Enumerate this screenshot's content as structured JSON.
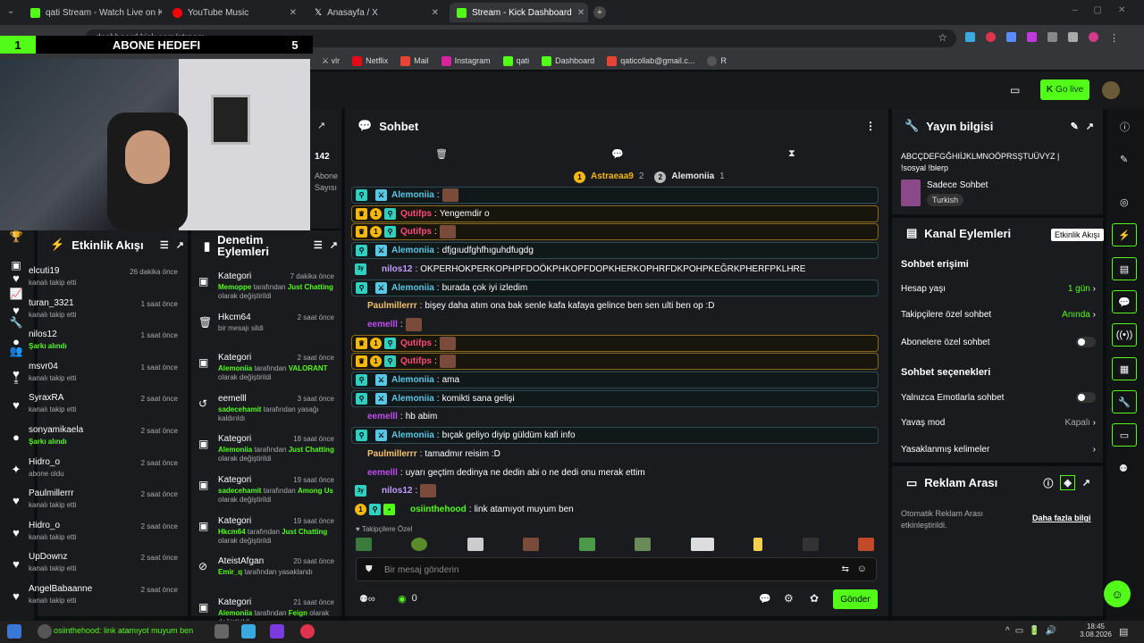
{
  "browser": {
    "tabs": [
      {
        "label": "qati Stream - Watch Live on Kic",
        "color": "#53fc18"
      },
      {
        "label": "YouTube Music",
        "color": "#ff0000"
      },
      {
        "label": "Anasayfa / X",
        "color": "#ffffff"
      },
      {
        "label": "Stream - Kick Dashboard",
        "color": "#53fc18"
      }
    ],
    "url": "dashboard.kick.com/stream",
    "bookmarks": [
      "Netflix",
      "Mail",
      "Instagram",
      "qati",
      "Dashboard",
      "qaticollab@gmail.c...",
      "R"
    ]
  },
  "overlay": {
    "goal_left": "1",
    "goal_title": "ABONE HEDEFI",
    "goal_right": "5"
  },
  "header": {
    "go_live": "Go live"
  },
  "stats": {
    "count": "142",
    "label1": "Abone",
    "label2": "Sayısı"
  },
  "events": {
    "title": "Etkinlik Akışı",
    "items": [
      {
        "name": "elcuti19",
        "sub": "kanalı takip etti",
        "time": "26 dakika önce",
        "icon": "♥",
        "g": false
      },
      {
        "name": "turan_3321",
        "sub": "kanalı takip etti",
        "time": "1 saat önce",
        "icon": "♥",
        "g": false
      },
      {
        "name": "nilos12",
        "sub": "Şarkı alındı",
        "time": "1 saat önce",
        "icon": "●",
        "g": true
      },
      {
        "name": "msvr04",
        "sub": "kanalı takip etti",
        "time": "1 saat önce",
        "icon": "♥",
        "g": false
      },
      {
        "name": "SyraxRA",
        "sub": "kanalı takip etti",
        "time": "2 saat önce",
        "icon": "♥",
        "g": false
      },
      {
        "name": "sonyamikaela",
        "sub": "Şarkı alındı",
        "time": "2 saat önce",
        "icon": "●",
        "g": true
      },
      {
        "name": "Hidro_o",
        "sub": "abone oldu",
        "time": "2 saat önce",
        "icon": "✦",
        "g": false
      },
      {
        "name": "Paulmillerrr",
        "sub": "kanalı takip etti",
        "time": "2 saat önce",
        "icon": "♥",
        "g": false
      },
      {
        "name": "Hidro_o",
        "sub": "kanalı takip etti",
        "time": "2 saat önce",
        "icon": "♥",
        "g": false
      },
      {
        "name": "UpDownz",
        "sub": "kanalı takip etti",
        "time": "2 saat önce",
        "icon": "♥",
        "g": false
      },
      {
        "name": "AngelBabaanne",
        "sub": "kanalı takip etti",
        "time": "2 saat önce",
        "icon": "♥",
        "g": false
      }
    ]
  },
  "mod": {
    "title1": "Denetim",
    "title2": "Eylemleri",
    "items": [
      {
        "name": "Kategori",
        "time": "7 dakika önce",
        "icon": "▣",
        "who": "Memoppe",
        "mid": " tarafından ",
        "what": "Just Chatting",
        "end": " olarak değiştirildi"
      },
      {
        "name": "Hkcm64",
        "time": "2 saat önce",
        "icon": "🗑",
        "who": "",
        "mid": "bir mesajı sildi",
        "what": "",
        "end": ""
      },
      {
        "name": "Kategori",
        "time": "2 saat önce",
        "icon": "▣",
        "who": "Alemoniia",
        "mid": " tarafından ",
        "what": "VALORANT",
        "end": " olarak değiştirildi"
      },
      {
        "name": "eemelll",
        "time": "3 saat önce",
        "icon": "↺",
        "who": "sadecehamit",
        "mid": " tarafından yasağı kaldırıldı",
        "what": "",
        "end": ""
      },
      {
        "name": "Kategori",
        "time": "18 saat önce",
        "icon": "▣",
        "who": "Alemoniia",
        "mid": " tarafından ",
        "what": "Just Chatting",
        "end": " olarak değiştirildi"
      },
      {
        "name": "Kategori",
        "time": "19 saat önce",
        "icon": "▣",
        "who": "sadecehamit",
        "mid": " tarafından ",
        "what": "Among Us",
        "end": " olarak değiştirildi"
      },
      {
        "name": "Kategori",
        "time": "19 saat önce",
        "icon": "▣",
        "who": "Hkcm64",
        "mid": " tarafından ",
        "what": "Just Chatting",
        "end": " olarak değiştirildi"
      },
      {
        "name": "AteistAfgan",
        "time": "20 saat önce",
        "icon": "⊘",
        "who": "Emir_q",
        "mid": " tarafından yasaklandı",
        "what": "",
        "end": ""
      },
      {
        "name": "Kategori",
        "time": "21 saat önce",
        "icon": "▣",
        "who": "Alemoniia",
        "mid": " tarafından ",
        "what": "Feign",
        "end": " olarak değiştirildi"
      }
    ]
  },
  "chat": {
    "title": "Sohbet",
    "top1": "Astraeaa9",
    "top1n": "2",
    "top2": "Alemoniia",
    "top2n": "1",
    "messages": [
      {
        "user": "Alemoniia",
        "text": "",
        "color": "#59c7e6",
        "style": "box",
        "emote": true
      },
      {
        "user": "Qutifps",
        "text": "Yengemdir o",
        "color": "#ff4a7d",
        "style": "gold",
        "emote": false
      },
      {
        "user": "Qutifps",
        "text": "",
        "color": "#ff4a7d",
        "style": "gold",
        "emote": true
      },
      {
        "user": "Alemoniia",
        "text": "dfjgıudfghfhıguhdfugdg",
        "color": "#59c7e6",
        "style": "box",
        "emote": false
      },
      {
        "user": "nilos12",
        "text": "OKPERHOKPERKOPHPFDOÖKPHKOPFDOPKHERKOPHRFDKPOHPKEĞRKPHERFPKLHRE",
        "color": "#c09cff",
        "style": "plain",
        "emote": false
      },
      {
        "user": "Alemoniia",
        "text": "burada çok iyi izledim",
        "color": "#59c7e6",
        "style": "box",
        "emote": false
      },
      {
        "user": "Paulmillerrr",
        "text": "bişey daha atım ona bak senle kafa kafaya gelince ben sen ulti ben op :D",
        "color": "#f3c26d",
        "style": "plain",
        "emote": false
      },
      {
        "user": "eemelll",
        "text": "",
        "color": "#c04cf0",
        "style": "plain",
        "emote": true
      },
      {
        "user": "Qutifps",
        "text": "",
        "color": "#ff4a7d",
        "style": "gold",
        "emote": true
      },
      {
        "user": "Qutifps",
        "text": "",
        "color": "#ff4a7d",
        "style": "gold",
        "emote": true
      },
      {
        "user": "Alemoniia",
        "text": "ama",
        "color": "#59c7e6",
        "style": "box",
        "emote": false
      },
      {
        "user": "Alemoniia",
        "text": "komikti sana gelişi",
        "color": "#59c7e6",
        "style": "box",
        "emote": false
      },
      {
        "user": "eemelll",
        "text": "hb abim",
        "color": "#c04cf0",
        "style": "plain",
        "emote": false
      },
      {
        "user": "Alemoniia",
        "text": "bıçak geliyo diyip güldüm kafi info",
        "color": "#59c7e6",
        "style": "box",
        "emote": false
      },
      {
        "user": "Paulmillerrr",
        "text": "tamadmır reisim :D",
        "color": "#f3c26d",
        "style": "plain",
        "emote": false
      },
      {
        "user": "eemelll",
        "text": "uyarı geçtim dedinya ne dedin abi o ne dedi onu merak ettim",
        "color": "#c04cf0",
        "style": "plain",
        "emote": false
      },
      {
        "user": "nilos12",
        "text": "",
        "color": "#c09cff",
        "style": "plain",
        "emote": true
      },
      {
        "user": "osiinthehood",
        "text": "link atamıyot muyum ben",
        "color": "#53fc18",
        "style": "plain",
        "emote": false
      }
    ],
    "followers_only": "Takipçilere Özel",
    "placeholder": "Bir mesaj gönderin",
    "send": "Gönder",
    "points": "0"
  },
  "info": {
    "title": "Yayın bilgisi",
    "stream_title": "ABCÇDEFGĞHIİJKLMNOÖPRSŞTUÜVYZ | !sosyal !blerp",
    "category": "Sadece Sohbet",
    "lang": "Turkish"
  },
  "actions": {
    "title": "Kanal Eylemleri",
    "tooltip": "Etkinlik Akışı",
    "sec1": "Sohbet erişimi",
    "rows1": [
      {
        "label": "Hesap yaşı",
        "value": "1 gün"
      },
      {
        "label": "Takipçilere özel sohbet",
        "value": "Anında"
      },
      {
        "label": "Abonelere özel sohbet",
        "value": ""
      }
    ],
    "sec2": "Sohbet seçenekleri",
    "rows2": [
      {
        "label": "Yalnızca Emotlarla sohbet",
        "value": ""
      },
      {
        "label": "Yavaş mod",
        "value": "Kapalı"
      },
      {
        "label": "Yasaklanmış kelimeler",
        "value": ""
      }
    ]
  },
  "ads": {
    "title": "Reklam Arası",
    "desc": "Otomatik Reklam Arası etkinleştirildi.",
    "link": "Daha fazla bilgi"
  },
  "taskbar": {
    "caption": "osiinthehood: link atamıyot muyum ben",
    "time": "18:45",
    "date": "3.08.2026"
  }
}
